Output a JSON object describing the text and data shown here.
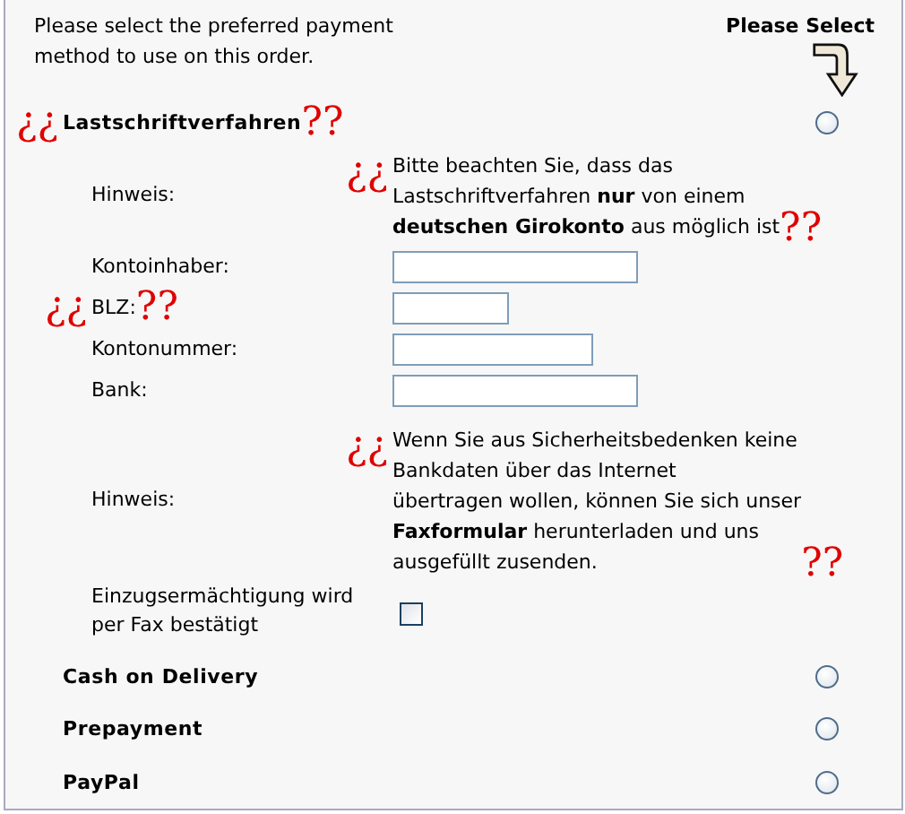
{
  "intro": "Please select the preferred payment method to use on this order.",
  "select_hint": "Please Select",
  "methods": [
    {
      "title": "Lastschriftverfahren",
      "open_mark": "¿¿",
      "close_mark": "??",
      "selected": false,
      "fields": [
        {
          "kind": "note",
          "label": "Hinweis:",
          "open_mark": "¿¿",
          "close_mark": "??",
          "lines": [
            "Bitte beachten Sie, dass das",
            "Lastschriftverfahren **nur** von einem",
            "**deutschen Girokonto** aus möglich ist"
          ]
        },
        {
          "kind": "wideinput",
          "label": "Kontoinhaber:"
        },
        {
          "kind": "shortinput",
          "label": "BLZ:",
          "open_mark": "¿¿",
          "close_mark": "??"
        },
        {
          "kind": "mediuminput",
          "label": "Kontonummer:"
        },
        {
          "kind": "wideinput",
          "label": "Bank:"
        },
        {
          "kind": "note",
          "label": "Hinweis:",
          "open_mark": "¿¿",
          "close_mark": "??",
          "lines": [
            "Wenn Sie aus Sicherheitsbedenken keine",
            "Bankdaten über das Internet",
            "übertragen wollen, können Sie sich unser",
            "**Faxformular** herunterladen und uns",
            "ausgefüllt zusenden."
          ]
        },
        {
          "kind": "checkbox",
          "label": "Einzugsermächtigung wird per Fax bestätigt",
          "checked": false
        }
      ]
    },
    {
      "title": "Cash on Delivery",
      "selected": false
    },
    {
      "title": "Prepayment",
      "selected": false
    },
    {
      "title": "PayPal",
      "selected": false
    }
  ]
}
